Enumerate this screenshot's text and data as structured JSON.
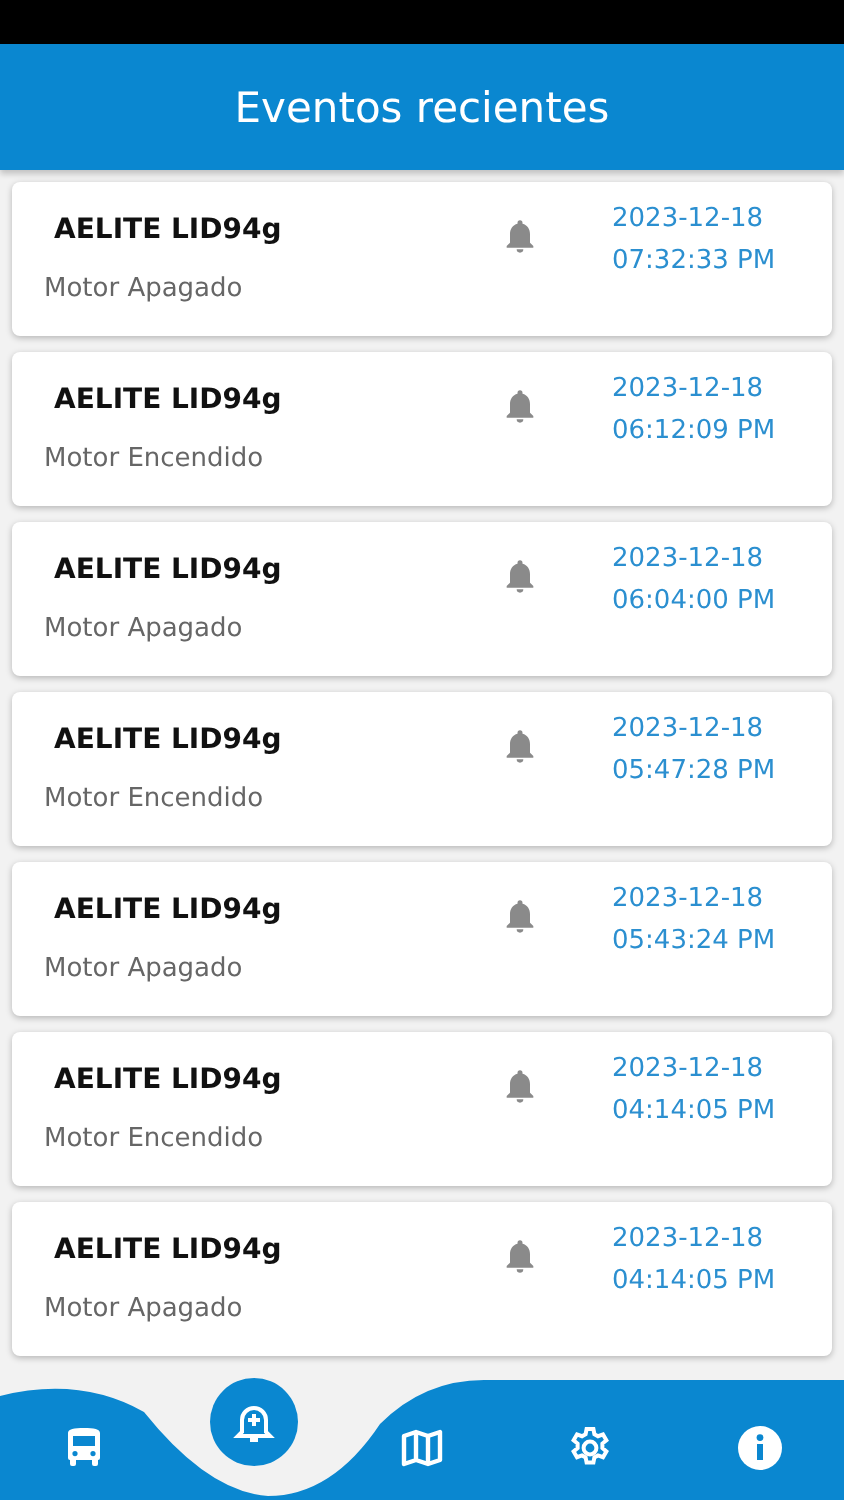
{
  "header": {
    "title": "Eventos recientes"
  },
  "events": [
    {
      "device": "AELITE LID94g",
      "event": "Motor Apagado",
      "date": "2023-12-18",
      "time": "07:32:33 PM"
    },
    {
      "device": "AELITE LID94g",
      "event": "Motor Encendido",
      "date": "2023-12-18",
      "time": "06:12:09 PM"
    },
    {
      "device": "AELITE LID94g",
      "event": "Motor Apagado",
      "date": "2023-12-18",
      "time": "06:04:00 PM"
    },
    {
      "device": "AELITE LID94g",
      "event": "Motor Encendido",
      "date": "2023-12-18",
      "time": "05:47:28 PM"
    },
    {
      "device": "AELITE LID94g",
      "event": "Motor Apagado",
      "date": "2023-12-18",
      "time": "05:43:24 PM"
    },
    {
      "device": "AELITE LID94g",
      "event": "Motor Encendido",
      "date": "2023-12-18",
      "time": "04:14:05 PM"
    },
    {
      "device": "AELITE LID94g",
      "event": "Motor Apagado",
      "date": "2023-12-18",
      "time": "04:14:05 PM"
    }
  ],
  "nav": [
    {
      "kind": "bus",
      "selected": false
    },
    {
      "kind": "alerts",
      "selected": true
    },
    {
      "kind": "map",
      "selected": false
    },
    {
      "kind": "settings",
      "selected": false
    },
    {
      "kind": "info",
      "selected": false
    }
  ]
}
